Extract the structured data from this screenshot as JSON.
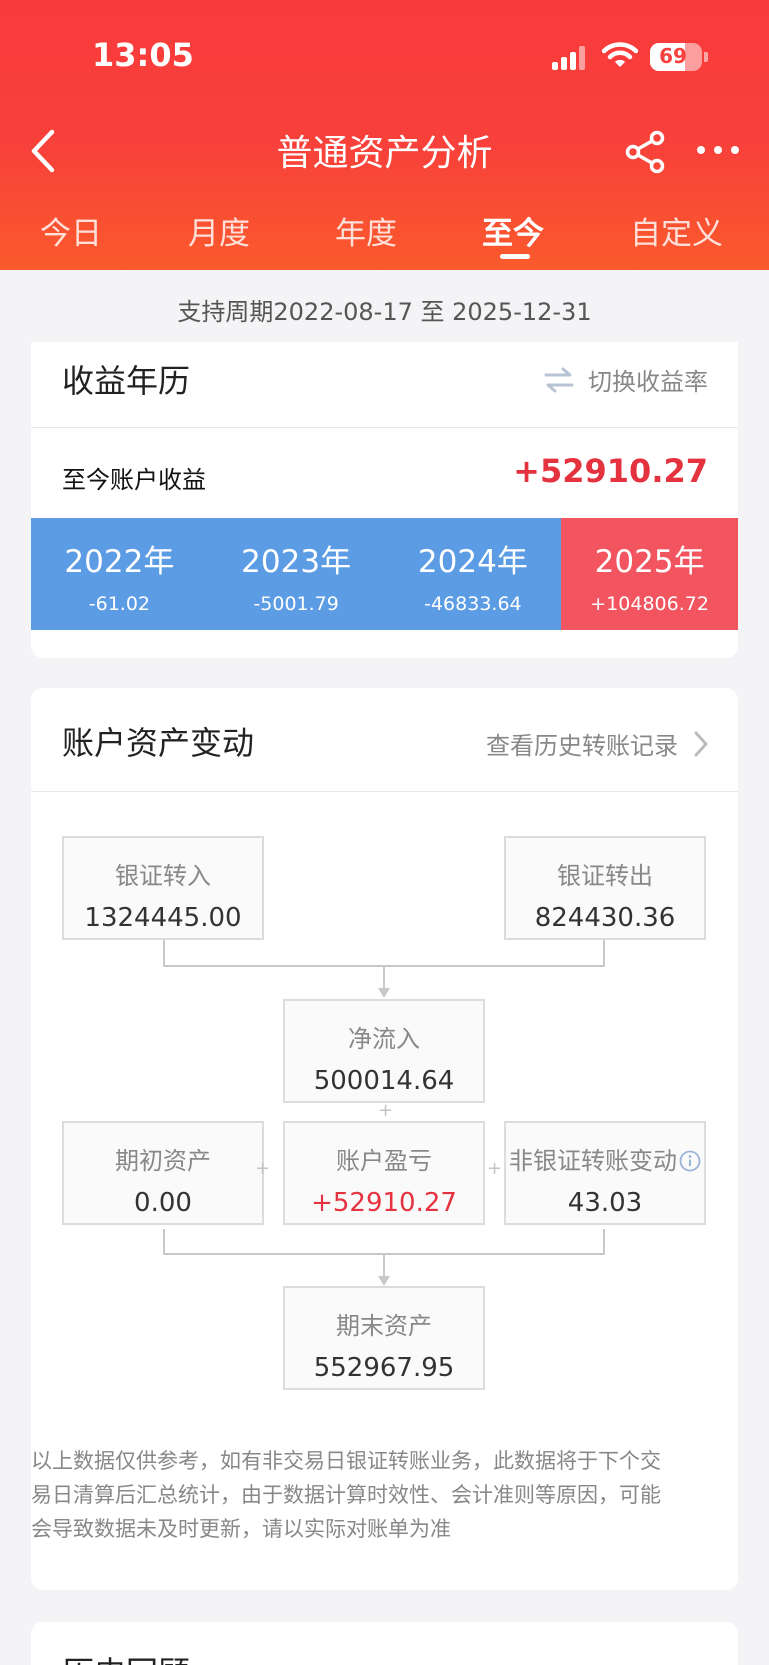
{
  "status_bar": {
    "time": "13:05",
    "battery": "69"
  },
  "header": {
    "title": "普通资产分析",
    "tabs": [
      {
        "label": "今日",
        "active": false
      },
      {
        "label": "月度",
        "active": false
      },
      {
        "label": "年度",
        "active": false
      },
      {
        "label": "至今",
        "active": true
      },
      {
        "label": "自定义",
        "active": false
      }
    ]
  },
  "period_text": "支持周期2022-08-17 至 2025-12-31",
  "calendar": {
    "title": "收益年历",
    "switch_label": "切换收益率",
    "total_label": "至今账户收益",
    "total_value": "+52910.27",
    "years": [
      {
        "year": "2022年",
        "value": "-61.02"
      },
      {
        "year": "2023年",
        "value": "-5001.79"
      },
      {
        "year": "2024年",
        "value": "-46833.64"
      },
      {
        "year": "2025年",
        "value": "+104806.72"
      }
    ]
  },
  "asset_change": {
    "title": "账户资产变动",
    "history_link": "查看历史转账记录",
    "bank_in": {
      "label": "银证转入",
      "value": "1324445.00"
    },
    "bank_out": {
      "label": "银证转出",
      "value": "824430.36"
    },
    "net_inflow": {
      "label": "净流入",
      "value": "500014.64"
    },
    "initial_assets": {
      "label": "期初资产",
      "value": "0.00"
    },
    "profit_loss": {
      "label": "账户盈亏",
      "value": "+52910.27"
    },
    "non_bank_change": {
      "label": "非银证转账变动",
      "value": "43.03"
    },
    "final_assets": {
      "label": "期末资产",
      "value": "552967.95"
    },
    "plus_sign": "+",
    "note": "以上数据仅供参考，如有非交易日银证转账业务，此数据将于下个交易日清算后汇总统计，由于数据计算时效性、会计准则等原因，可能会导致数据未及时更新，请以实际对账单为准"
  },
  "history_review": {
    "title": "历史回顾"
  },
  "colors": {
    "brand_red": "#f83a3c",
    "loss_blue": "#5b9ce5",
    "gain_red": "#f25560",
    "value_red": "#e5323f"
  }
}
